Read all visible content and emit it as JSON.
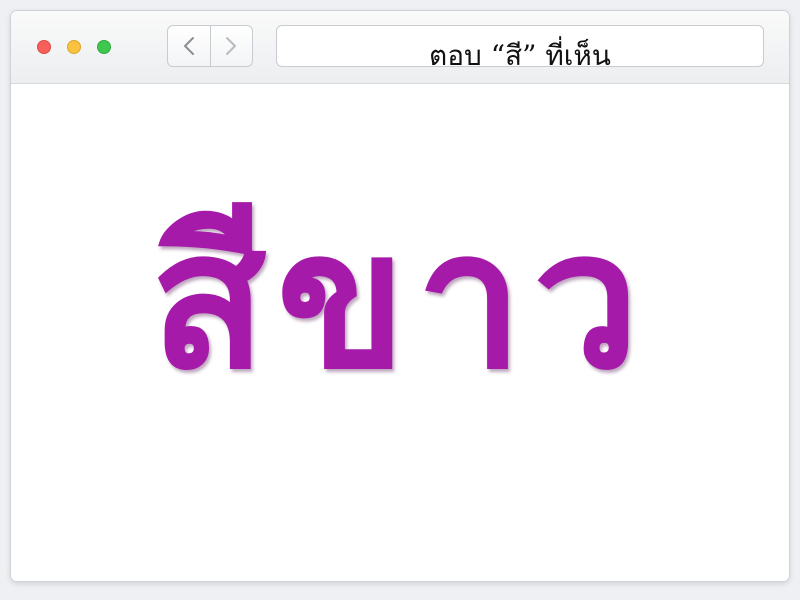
{
  "browser": {
    "address_text": "ตอบ “สี” ที่เห็น",
    "buttons": {
      "back_icon": "chevron-left-icon",
      "forward_icon": "chevron-right-icon"
    }
  },
  "content": {
    "word": "สีขาว",
    "word_color": "#a51aa8"
  }
}
